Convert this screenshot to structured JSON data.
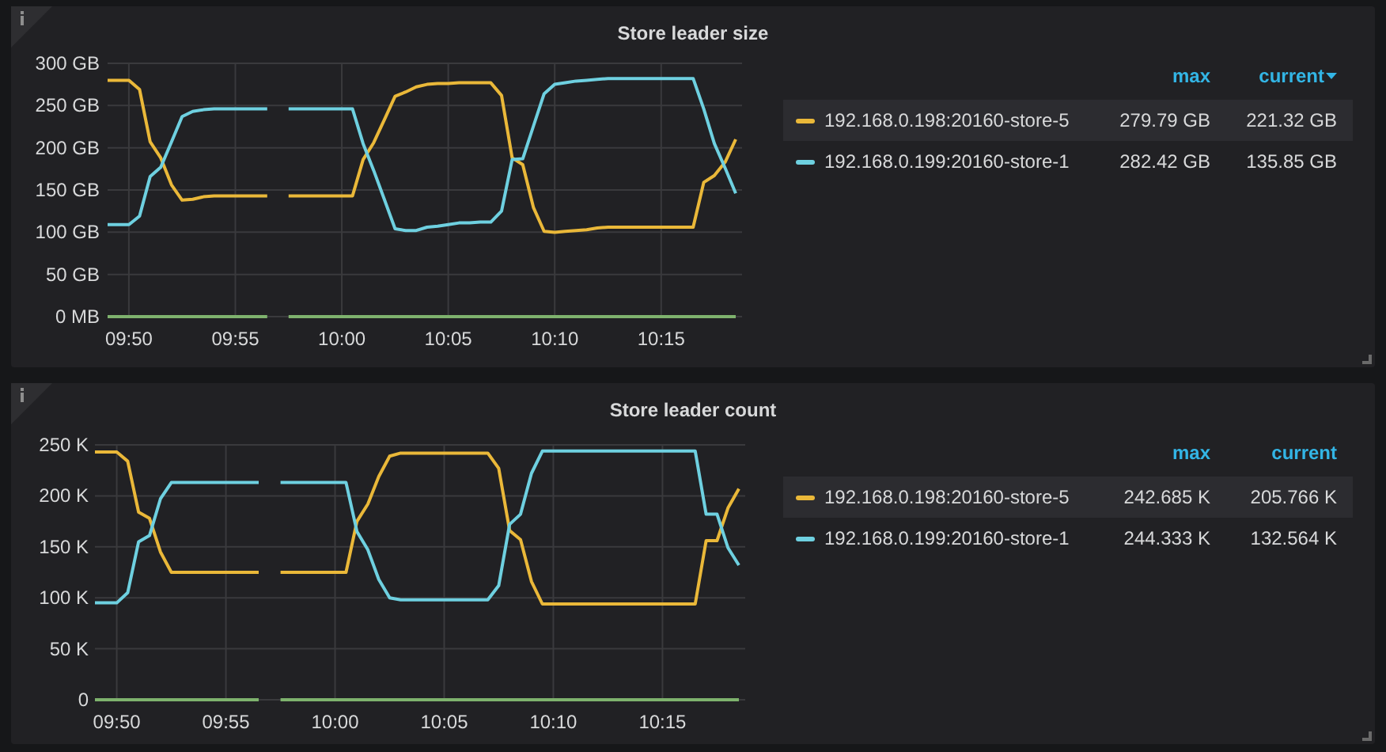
{
  "panels": [
    {
      "title": "Store leader size",
      "legend": {
        "columns": [
          {
            "label": "max",
            "sorted": false
          },
          {
            "label": "current",
            "sorted": true
          }
        ],
        "rows": [
          {
            "highlighted": true,
            "max": "279.79 GB",
            "current": "221.32 GB"
          },
          {
            "highlighted": false,
            "max": "282.42 GB",
            "current": "135.85 GB"
          }
        ]
      },
      "chart_data": {
        "type": "line",
        "grid": true,
        "ylim": [
          0,
          300
        ],
        "yticks": [
          {
            "value": 0,
            "label": "0 MB"
          },
          {
            "value": 50,
            "label": "50 GB"
          },
          {
            "value": 100,
            "label": "100 GB"
          },
          {
            "value": 150,
            "label": "150 GB"
          },
          {
            "value": 200,
            "label": "200 GB"
          },
          {
            "value": 250,
            "label": "250 GB"
          },
          {
            "value": 300,
            "label": "300 GB"
          }
        ],
        "categories": [
          null,
          null,
          "09:50",
          null,
          null,
          null,
          null,
          null,
          null,
          null,
          null,
          null,
          "09:55",
          null,
          null,
          null,
          null,
          null,
          null,
          null,
          null,
          null,
          "10:00",
          null,
          null,
          null,
          null,
          null,
          null,
          null,
          null,
          null,
          "10:05",
          null,
          null,
          null,
          null,
          null,
          null,
          null,
          null,
          null,
          "10:10",
          null,
          null,
          null,
          null,
          null,
          null,
          null,
          null,
          null,
          "10:15",
          null,
          null,
          null,
          null,
          null,
          null,
          null
        ],
        "series": [
          {
            "name": "192.168.0.198:20160-store-5",
            "color": "#eab839",
            "values": [
              280,
              280,
              280,
              269,
              207,
              188,
              156,
              138,
              139,
              142,
              143,
              143,
              143,
              143,
              143,
              143,
              null,
              143,
              143,
              143,
              143,
              143,
              143,
              143,
              186,
              206,
              233,
              261,
              266,
              272,
              275,
              276,
              276,
              277,
              277,
              277,
              277,
              262,
              188,
              180,
              129,
              101,
              100,
              101,
              102,
              103,
              105,
              106,
              106,
              106,
              106,
              106,
              106,
              106,
              106,
              106,
              159,
              167,
              183,
              210
            ]
          },
          {
            "name": "192.168.0.199:20160-store-1",
            "color": "#6ed0e0",
            "values": [
              109,
              109,
              109,
              119,
              166,
              177,
              207,
              237,
              243,
              245,
              246,
              246,
              246,
              246,
              246,
              246,
              null,
              246,
              246,
              246,
              246,
              246,
              246,
              246,
              205,
              173,
              139,
              104,
              102,
              102,
              106,
              107,
              109,
              111,
              111,
              112,
              112,
              125,
              186,
              187,
              226,
              264,
              275,
              277,
              279,
              280,
              281,
              282,
              282,
              282,
              282,
              282,
              282,
              282,
              282,
              282,
              246,
              205,
              176,
              146
            ]
          },
          {
            "color": "#7eb26d",
            "values": [
              0,
              0,
              0,
              0,
              0,
              0,
              0,
              0,
              0,
              0,
              0,
              0,
              0,
              0,
              0,
              0,
              null,
              0,
              0,
              0,
              0,
              0,
              0,
              0,
              0,
              0,
              0,
              0,
              0,
              0,
              0,
              0,
              0,
              0,
              0,
              0,
              0,
              0,
              0,
              0,
              0,
              0,
              0,
              0,
              0,
              0,
              0,
              0,
              0,
              0,
              0,
              0,
              0,
              0,
              0,
              0,
              0,
              0,
              0,
              0
            ]
          }
        ]
      }
    },
    {
      "title": "Store leader count",
      "legend": {
        "columns": [
          {
            "label": "max",
            "sorted": false
          },
          {
            "label": "current",
            "sorted": false
          }
        ],
        "rows": [
          {
            "highlighted": true,
            "max": "242.685 K",
            "current": "205.766 K"
          },
          {
            "highlighted": false,
            "max": "244.333 K",
            "current": "132.564 K"
          }
        ]
      },
      "chart_data": {
        "type": "line",
        "grid": true,
        "ylim": [
          0,
          250
        ],
        "yticks": [
          {
            "value": 0,
            "label": "0"
          },
          {
            "value": 50,
            "label": "50 K"
          },
          {
            "value": 100,
            "label": "100 K"
          },
          {
            "value": 150,
            "label": "150 K"
          },
          {
            "value": 200,
            "label": "200 K"
          },
          {
            "value": 250,
            "label": "250 K"
          }
        ],
        "categories": [
          null,
          null,
          "09:50",
          null,
          null,
          null,
          null,
          null,
          null,
          null,
          null,
          null,
          "09:55",
          null,
          null,
          null,
          null,
          null,
          null,
          null,
          null,
          null,
          "10:00",
          null,
          null,
          null,
          null,
          null,
          null,
          null,
          null,
          null,
          "10:05",
          null,
          null,
          null,
          null,
          null,
          null,
          null,
          null,
          null,
          "10:10",
          null,
          null,
          null,
          null,
          null,
          null,
          null,
          null,
          null,
          "10:15",
          null,
          null,
          null,
          null,
          null,
          null,
          null
        ],
        "series": [
          {
            "name": "192.168.0.198:20160-store-5",
            "color": "#eab839",
            "values": [
              243,
              243,
              243,
              234,
              184,
              178,
              145,
              125,
              125,
              125,
              125,
              125,
              125,
              125,
              125,
              125,
              null,
              125,
              125,
              125,
              125,
              125,
              125,
              125,
              175,
              192,
              219,
              239,
              242,
              242,
              242,
              242,
              242,
              242,
              242,
              242,
              242,
              227,
              166,
              157,
              116,
              94,
              94,
              94,
              94,
              94,
              94,
              94,
              94,
              94,
              94,
              94,
              94,
              94,
              94,
              94,
              156,
              156,
              188,
              207
            ]
          },
          {
            "name": "192.168.0.199:20160-store-1",
            "color": "#6ed0e0",
            "values": [
              95,
              95,
              95,
              105,
              155,
              161,
              197,
              213,
              213,
              213,
              213,
              213,
              213,
              213,
              213,
              213,
              null,
              213,
              213,
              213,
              213,
              213,
              213,
              213,
              165,
              147,
              118,
              100,
              98,
              98,
              98,
              98,
              98,
              98,
              98,
              98,
              98,
              112,
              172,
              182,
              222,
              244,
              244,
              244,
              244,
              244,
              244,
              244,
              244,
              244,
              244,
              244,
              244,
              244,
              244,
              244,
              182,
              182,
              149,
              132
            ]
          },
          {
            "color": "#7eb26d",
            "values": [
              0,
              0,
              0,
              0,
              0,
              0,
              0,
              0,
              0,
              0,
              0,
              0,
              0,
              0,
              0,
              0,
              null,
              0,
              0,
              0,
              0,
              0,
              0,
              0,
              0,
              0,
              0,
              0,
              0,
              0,
              0,
              0,
              0,
              0,
              0,
              0,
              0,
              0,
              0,
              0,
              0,
              0,
              0,
              0,
              0,
              0,
              0,
              0,
              0,
              0,
              0,
              0,
              0,
              0,
              0,
              0,
              0,
              0,
              0,
              0
            ]
          }
        ]
      }
    }
  ]
}
